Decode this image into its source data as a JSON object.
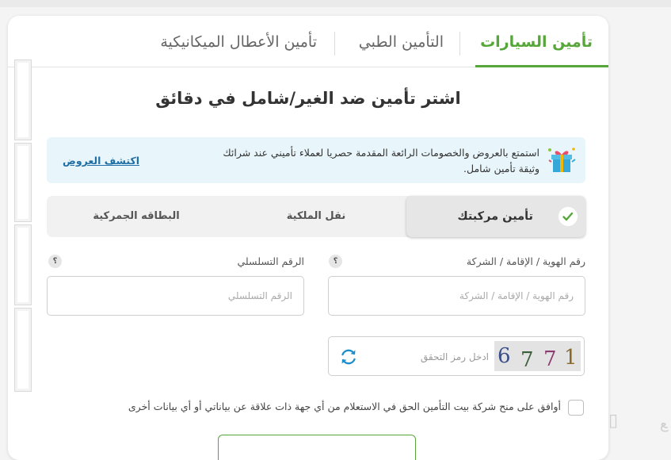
{
  "tabs": [
    {
      "label": "تأمين السيارات",
      "active": true
    },
    {
      "label": "التأمين الطبي",
      "active": false
    },
    {
      "label": "تأمين الأعطال الميكانيكية",
      "active": false
    }
  ],
  "title": "اشتر تأمين ضد الغير/شامل في دقائق",
  "banner": {
    "text": "استمتع بالعروض والخصومات الرائعة المقدمة حصريا لعملاء تأميني عند شرائك وثيقة تأمين شامل.",
    "link": "اكتشف العروض",
    "icon": "gift-icon"
  },
  "segments": [
    {
      "label": "تأمين مركبتك",
      "active": true
    },
    {
      "label": "نقل الملكية",
      "active": false
    },
    {
      "label": "البطاقه الجمركية",
      "active": false
    }
  ],
  "fields": {
    "id": {
      "label": "رقم الهوية / الإقامة / الشركة",
      "placeholder": "رقم الهوية / الإقامة / الشركة",
      "value": ""
    },
    "serial": {
      "label": "الرقم التسلسلي",
      "placeholder": "الرقم التسلسلي",
      "value": ""
    },
    "help": "؟"
  },
  "captcha": {
    "placeholder": "ادخل رمز التحقق",
    "digits": [
      "6",
      "7",
      "7",
      "1"
    ],
    "digit_colors": [
      "#3a4f8a",
      "#3d5e3a",
      "#8a3d6e",
      "#8a6a2a"
    ]
  },
  "agreement": {
    "text": "أوافق على منح شركة بيت التأمين الحق في الاستعلام من أي جهة ذات علاقة عن بياناتي أو أي بيانات أخرى",
    "checked": false
  },
  "colors": {
    "accent": "#57a63a",
    "link": "#1f6fa5",
    "banner_bg": "#e8f6fb"
  }
}
